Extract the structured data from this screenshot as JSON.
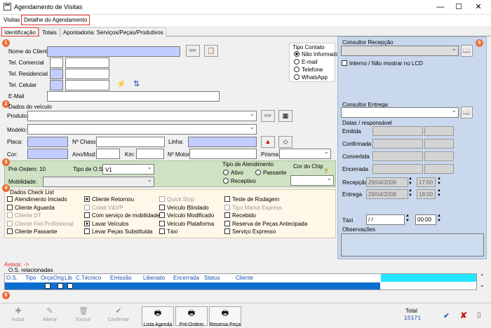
{
  "window": {
    "title": "Agendamento de Visitas",
    "min": "—",
    "max": "☐",
    "close": "✕"
  },
  "menu": [
    "Visitas",
    "Detalhe do Agendamento"
  ],
  "tabs": [
    "Identificação",
    "Totais",
    "Apontadoria: Serviços/Peças/Produtivos"
  ],
  "badges": [
    "1",
    "2",
    "3",
    "4",
    "5",
    "6"
  ],
  "client": {
    "nome_label": "Nome do Cliente",
    "tel_comercial": "Tel. Comercial",
    "tel_residencial": "Tel. Residencial",
    "tel_celular": "Tel. Celular",
    "email": "E-Mail"
  },
  "tipo_contato": {
    "label": "Tipo Contato",
    "options": [
      "Não Informado",
      "E-mail",
      "Telefone",
      "WhatsApp"
    ]
  },
  "veiculo": {
    "legend": "Dados do veículo",
    "produto": "Produto:",
    "modelo": "Modelo:",
    "placa": "Placa:",
    "chassi": "Nº Chassi:",
    "linha": "Linha:",
    "cor": "Cor:",
    "ano": "Ano/Mod:",
    "km": "Km:",
    "motor": "Nº Motor:",
    "prisma": "Prisma:"
  },
  "os": {
    "pre_ordem": "Pré-Ordem: 10",
    "tipo_os": "Tipo de O.S:",
    "tipo_val": "V1",
    "mobilidade": "Mobilidade:",
    "tipo_atend": "Tipo de Atendimento",
    "ativo": "Ativo",
    "passante": "Passante",
    "receptivo": "Receptivo",
    "cor_chip": "Cor do Chip",
    "help": "?"
  },
  "checklist": {
    "legend": "Dados Check List",
    "col1": [
      {
        "t": "Atendimento Iniciado",
        "s": "off"
      },
      {
        "t": "Cliente Aguarda",
        "s": "off"
      },
      {
        "t": "Cliente DT",
        "s": "dis"
      },
      {
        "t": "Cliente Fiel Profissional",
        "s": "dis"
      },
      {
        "t": "Cliente Passante",
        "s": "off"
      }
    ],
    "col2": [
      {
        "t": "Cliente Retornou",
        "s": "on"
      },
      {
        "t": "Colab V&VP",
        "s": "dis"
      },
      {
        "t": "Com serviço de mobilidade",
        "s": "off"
      },
      {
        "t": "Lavar Veículos",
        "s": "on"
      },
      {
        "t": "Levar Peças Substituida",
        "s": "off"
      }
    ],
    "col3": [
      {
        "t": "Quick Stop",
        "s": "dis"
      },
      {
        "t": "Veículo Blindado",
        "s": "off"
      },
      {
        "t": "Veículo Modificado",
        "s": "off"
      },
      {
        "t": "Veículo Plataforma",
        "s": "off"
      },
      {
        "t": "Táxi",
        "s": "off"
      }
    ],
    "col4": [
      {
        "t": "Teste de Rodagem",
        "s": "off"
      },
      {
        "t": "Tipo Manut Express",
        "s": "dis"
      },
      {
        "t": "Recebido",
        "s": "off"
      },
      {
        "t": "Reserva de Peças Antecipada",
        "s": "off"
      },
      {
        "t": "Serviço Expresso",
        "s": "off"
      }
    ]
  },
  "consultor": {
    "recepcao": "Consultor Recepção",
    "interno": "Interno / Não mostrar no LCD",
    "entrega": "Consultor Entrega:",
    "datas": "Datas / responsável",
    "emitida": "Emitida",
    "confirmada": "Confirmada",
    "convertida": "Convertida",
    "encerrada": "Encerrada",
    "recepcao_lbl": "Recepção",
    "recepcao_date": "29/04/2008",
    "recepcao_time": "17:00",
    "entrega_lbl": "Entrega",
    "entrega_date": "29/04/2008",
    "entrega_time": "18:00",
    "taxi": "Táxi",
    "taxi_date": "/ /",
    "taxi_time": "00:00",
    "obs": "Observações"
  },
  "avisos": "Avisos: ->",
  "grid": {
    "legend": "O.S. relacionadas",
    "cols": [
      "O.S.",
      "Tipo",
      "Orça",
      "Orig",
      "Lib",
      "C.Técnico",
      "Emissão",
      "Liberado",
      "Encerrada",
      "Status",
      "Cliente"
    ]
  },
  "toolbar": [
    {
      "t": "Incluir",
      "i": "✚",
      "en": false
    },
    {
      "t": "Alterar",
      "i": "✎",
      "en": false
    },
    {
      "t": "Excluir",
      "i": "🗑",
      "en": false
    },
    {
      "t": "Confirmar",
      "i": "✔",
      "en": false
    },
    {
      "t": "Lista Agenda",
      "i": "🖶",
      "en": true
    },
    {
      "t": "Pré-Ordem",
      "i": "🖶",
      "en": true
    },
    {
      "t": "Reserva Peça",
      "i": "🖶",
      "en": true
    }
  ],
  "total": {
    "label": "Total",
    "value": "15171"
  }
}
